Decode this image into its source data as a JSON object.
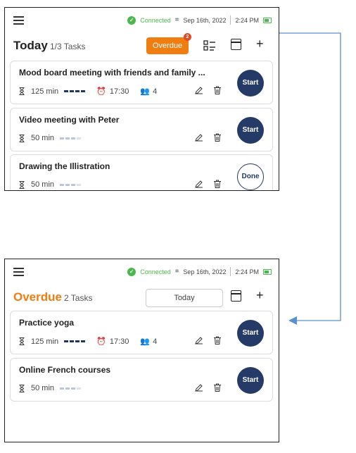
{
  "colors": {
    "accent": "#f07d10",
    "navy": "#253a66",
    "connected": "#4bb84b",
    "arrow": "#5b8fd0"
  },
  "status": {
    "connected": "Connected",
    "date": "Sep 16th, 2022",
    "time": "2:24 PM"
  },
  "screen1": {
    "title": "Today",
    "count": "1/3 Tasks",
    "overdue_label": "Overdue",
    "overdue_badge": "2",
    "tasks": [
      {
        "name": "Mood board meeting with friends and family ...",
        "duration": "125 min",
        "time": "17:30",
        "people": "4",
        "action": "Start"
      },
      {
        "name": "Video meeting with Peter",
        "duration": "50 min",
        "action": "Start"
      },
      {
        "name": "Drawing the Illistration",
        "duration": "50 min",
        "action": "Done"
      }
    ]
  },
  "screen2": {
    "title": "Overdue",
    "count": "2 Tasks",
    "today_label": "Today",
    "tasks": [
      {
        "name": "Practice yoga",
        "duration": "125 min",
        "time": "17:30",
        "people": "4",
        "action": "Start"
      },
      {
        "name": "Online French courses",
        "duration": "50 min",
        "action": "Start"
      }
    ]
  }
}
